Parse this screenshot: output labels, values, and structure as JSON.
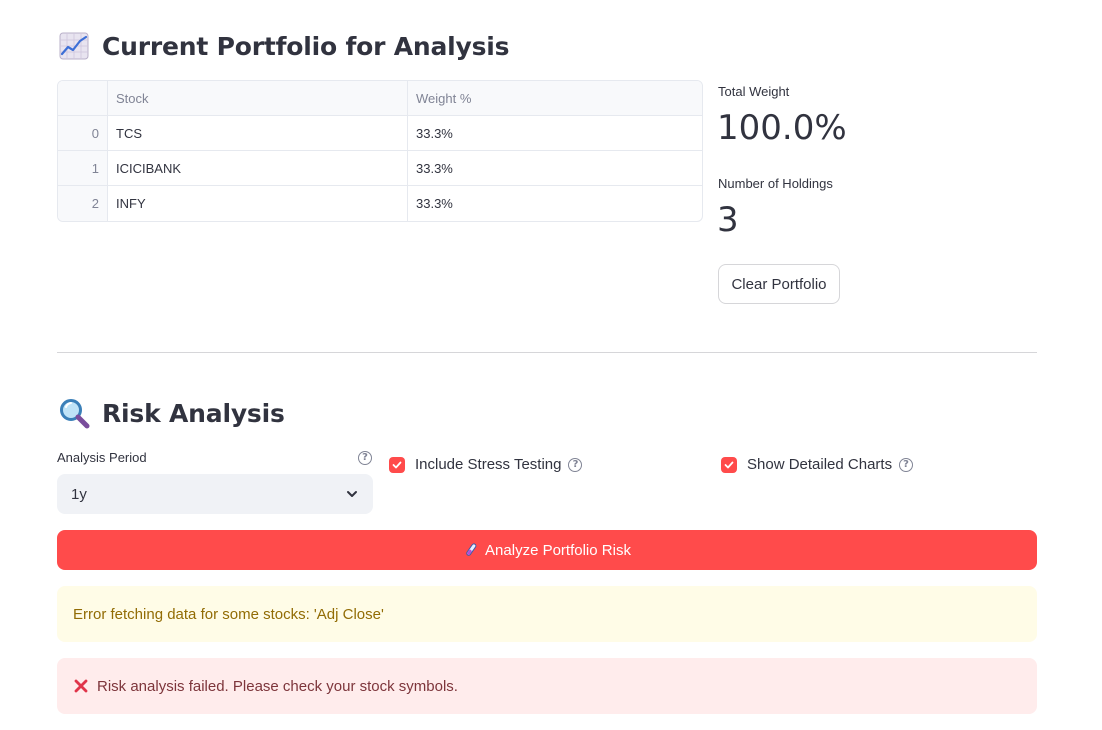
{
  "portfolio": {
    "title": "Current Portfolio for Analysis",
    "title_icon": "chart-increasing-icon",
    "table": {
      "columns": [
        "",
        "Stock",
        "Weight %"
      ],
      "rows": [
        {
          "index": "0",
          "stock": "TCS",
          "weight": "33.3%"
        },
        {
          "index": "1",
          "stock": "ICICIBANK",
          "weight": "33.3%"
        },
        {
          "index": "2",
          "stock": "INFY",
          "weight": "33.3%"
        }
      ]
    },
    "metrics": {
      "total_weight_label": "Total Weight",
      "total_weight_value": "100.0%",
      "holdings_label": "Number of Holdings",
      "holdings_value": "3"
    },
    "clear_button_label": "Clear Portfolio"
  },
  "risk": {
    "title": "Risk Analysis",
    "title_icon": "magnifying-glass-icon",
    "period": {
      "label": "Analysis Period",
      "selected": "1y"
    },
    "stress_testing": {
      "label": "Include Stress Testing",
      "checked": true
    },
    "detailed_charts": {
      "label": "Show Detailed Charts",
      "checked": true
    },
    "analyze_button_label": "Analyze Portfolio Risk",
    "analyze_button_icon": "test-tube-icon",
    "warning_text": "Error fetching data for some stocks: 'Adj Close'",
    "error_text": "Risk analysis failed. Please check your stock symbols.",
    "error_icon": "cross-mark-icon"
  },
  "colors": {
    "primary": "#ff4b4b",
    "text": "#31333f",
    "warning_bg": "#fffce7",
    "warning_text": "#926c05",
    "error_bg": "#ffecec",
    "error_text": "#7d353b"
  }
}
